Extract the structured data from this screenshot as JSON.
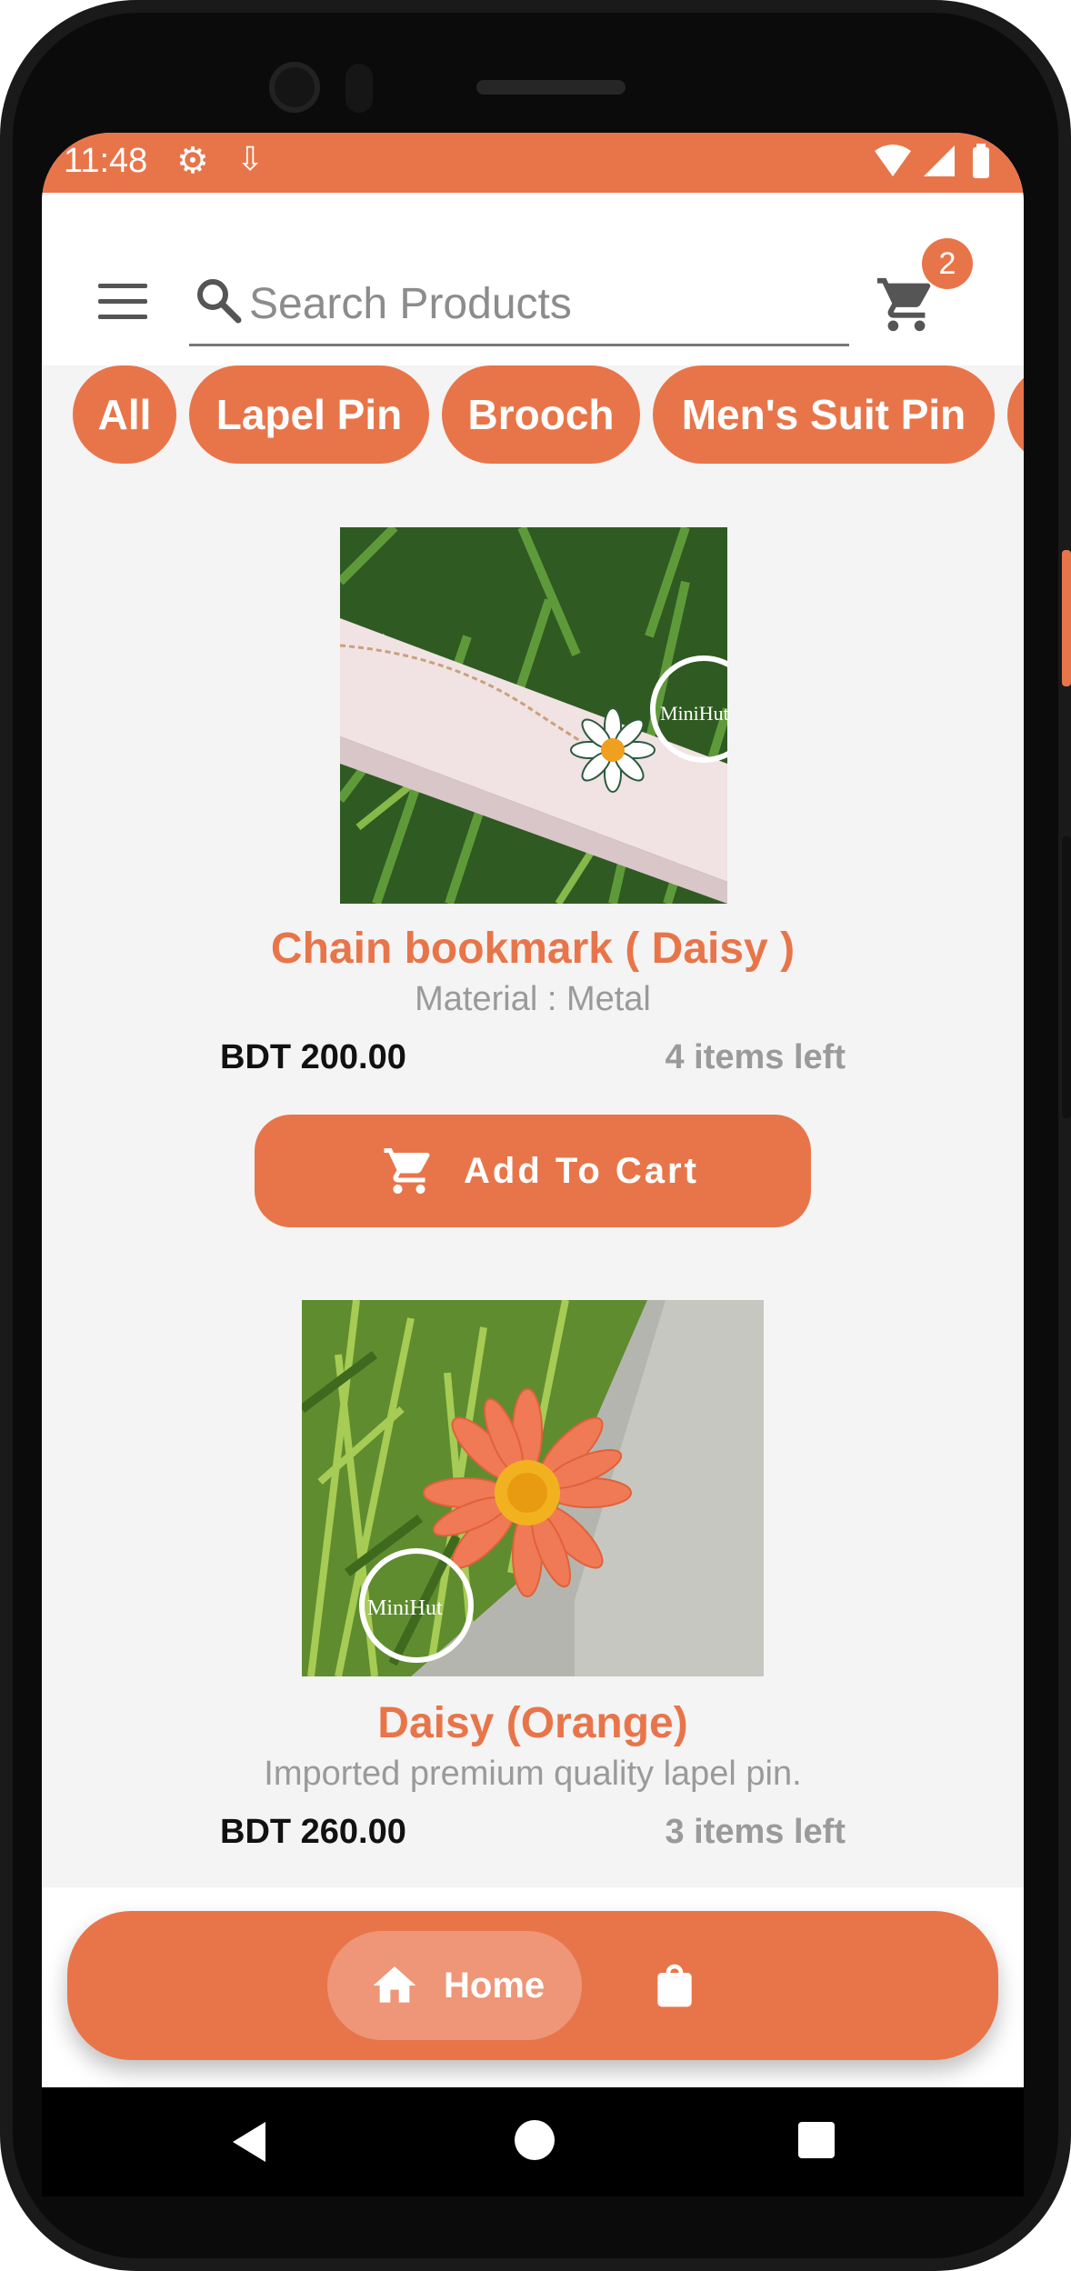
{
  "status_bar": {
    "time": "11:48"
  },
  "search": {
    "placeholder": "Search Products"
  },
  "cart": {
    "badge_count": "2"
  },
  "categories": [
    "All",
    "Lapel Pin",
    "Brooch",
    "Men's Suit Pin"
  ],
  "products": [
    {
      "title": "Chain bookmark ( Daisy )",
      "description": "Material : Metal",
      "price": "BDT 200.00",
      "stock": "4 items left",
      "add_label": "Add To Cart",
      "watermark": "MiniHut"
    },
    {
      "title": "Daisy (Orange)",
      "description": "Imported premium quality lapel pin.",
      "price": "BDT 260.00",
      "stock": "3 items left",
      "watermark": "MiniHut"
    }
  ],
  "bottom_nav": {
    "home_label": "Home"
  },
  "colors": {
    "accent": "#e8754a",
    "accent_light": "#ee9677",
    "background": "#f4f4f4"
  },
  "icons": [
    "menu-icon",
    "search-icon",
    "cart-icon",
    "gear-icon",
    "download-icon",
    "wifi-icon",
    "signal-icon",
    "battery-icon",
    "home-icon",
    "shopping-bag-icon",
    "back-icon"
  ]
}
